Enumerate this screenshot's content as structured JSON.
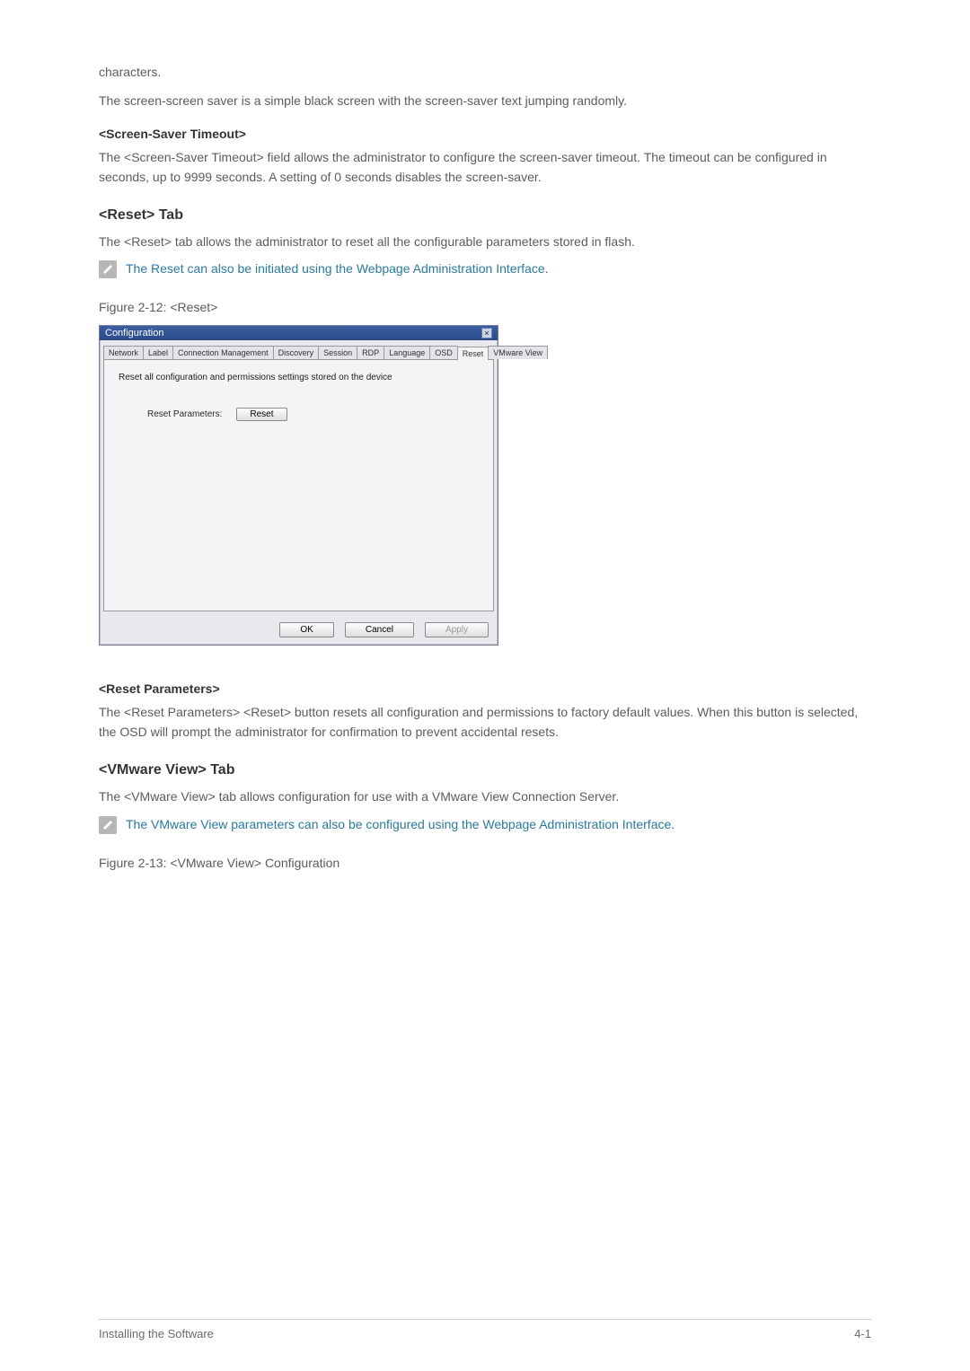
{
  "intro": {
    "fragment": "characters.",
    "saver_desc": "The screen-screen saver is a simple black screen with the screen-saver text jumping randomly."
  },
  "screen_saver_timeout": {
    "heading": "<Screen-Saver Timeout>",
    "body": "The <Screen-Saver Timeout> field allows the administrator to configure the screen-saver timeout. The timeout can be configured in seconds, up to 9999 seconds. A setting of 0 seconds disables the screen-saver."
  },
  "reset_tab": {
    "heading": "<Reset> Tab",
    "body": "The <Reset> tab allows the administrator to reset all the configurable parameters stored in flash.",
    "note": "The Reset can also be initiated using the Webpage Administration Interface.",
    "figure_caption": "Figure 2-12: <Reset>"
  },
  "dialog": {
    "title": "Configuration",
    "tabs": [
      "Network",
      "Label",
      "Connection Management",
      "Discovery",
      "Session",
      "RDP",
      "Language",
      "OSD",
      "Reset",
      "VMware View"
    ],
    "active_tab_index": 8,
    "panel_desc": "Reset all configuration and permissions settings stored on the device",
    "reset_param_label": "Reset Parameters:",
    "reset_button": "Reset",
    "ok": "OK",
    "cancel": "Cancel",
    "apply": "Apply"
  },
  "reset_params": {
    "heading": "<Reset Parameters>",
    "body": "The <Reset Parameters> <Reset> button resets all configuration and permissions to factory default values. When this button is selected, the OSD will prompt the administrator for confirmation to prevent accidental resets."
  },
  "vmware_view": {
    "heading": "<VMware View> Tab",
    "body": "The <VMware View> tab allows configuration for use with a VMware View Connection Server.",
    "note": "The VMware View parameters can also be configured using the Webpage Administration Interface.",
    "figure_caption": "Figure 2-13: <VMware View> Configuration"
  },
  "footer": {
    "left": "Installing the Software",
    "right": "4-1"
  }
}
